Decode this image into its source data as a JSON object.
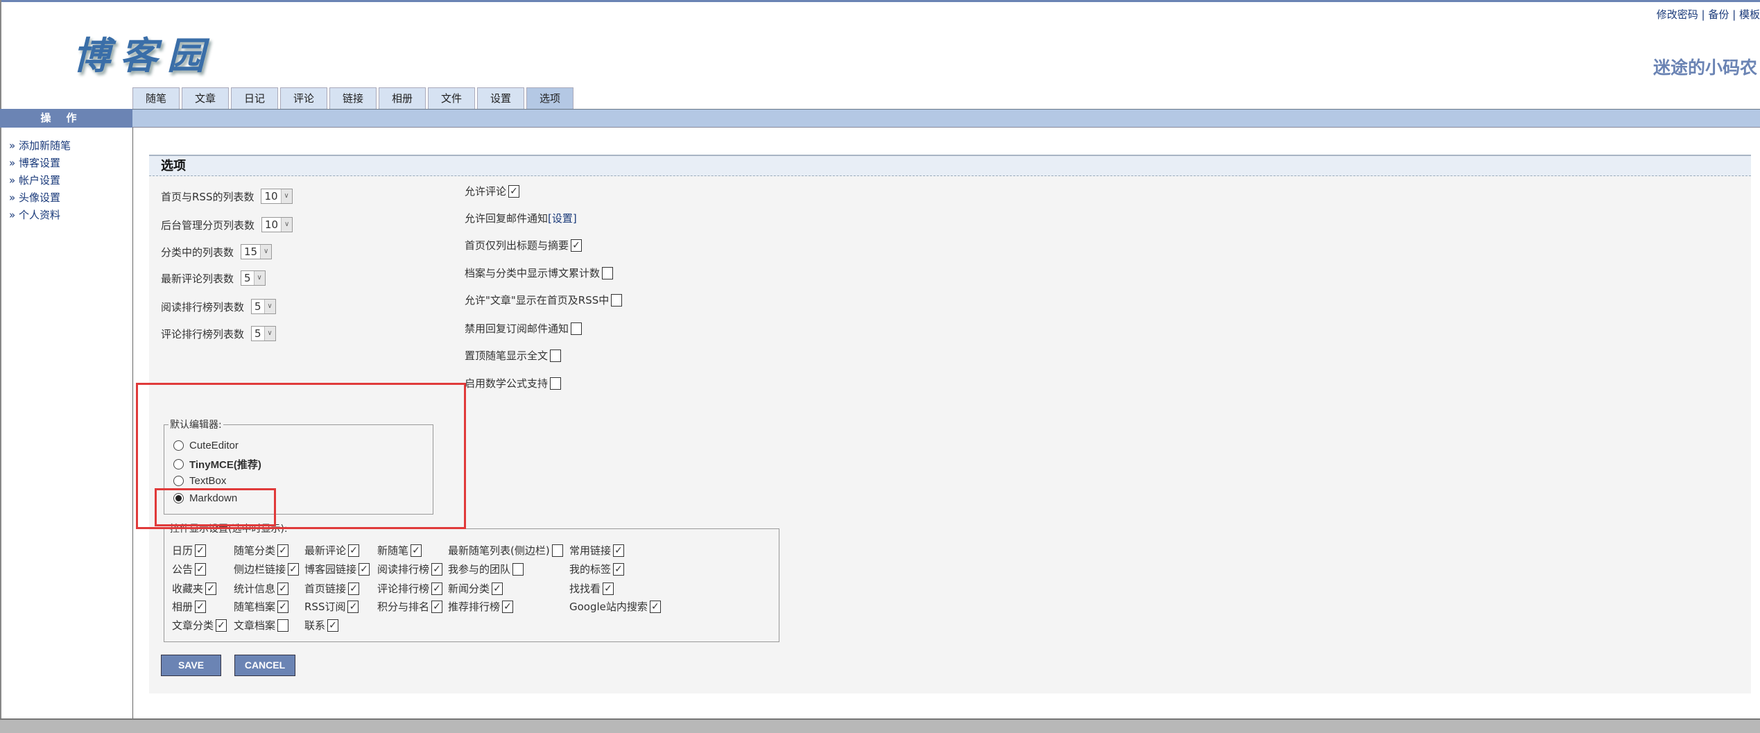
{
  "header": {
    "logo_text": "博客园",
    "links": [
      "修改密码",
      "备份",
      "模板"
    ],
    "blog_name": "迷途的小码农"
  },
  "tabs": [
    {
      "label": "随笔"
    },
    {
      "label": "文章"
    },
    {
      "label": "日记"
    },
    {
      "label": "评论"
    },
    {
      "label": "链接"
    },
    {
      "label": "相册"
    },
    {
      "label": "文件"
    },
    {
      "label": "设置"
    },
    {
      "label": "选项",
      "selected": true
    }
  ],
  "sidebar": {
    "title": "操作",
    "items": [
      "» 添加新随笔",
      "» 博客设置",
      "» 帐户设置",
      "» 头像设置",
      "» 个人资料"
    ]
  },
  "panel": {
    "title": "选项",
    "selects": [
      {
        "label": "首页与RSS的列表数",
        "value": "10"
      },
      {
        "label": "后台管理分页列表数",
        "value": "10"
      },
      {
        "label": "分类中的列表数",
        "value": "15"
      },
      {
        "label": "最新评论列表数",
        "value": "5"
      },
      {
        "label": "阅读排行榜列表数",
        "value": "5"
      },
      {
        "label": "评论排行榜列表数",
        "value": "5"
      }
    ],
    "options": [
      {
        "label": "允许评论",
        "checked": true
      },
      {
        "label": "允许回复邮件通知",
        "link": "[设置]"
      },
      {
        "label": "首页仅列出标题与摘要",
        "checked": true
      },
      {
        "label": "档案与分类中显示博文累计数",
        "checked": false
      },
      {
        "label": "允许\"文章\"显示在首页及RSS中",
        "checked": false
      },
      {
        "label": "禁用回复订阅邮件通知",
        "checked": false
      },
      {
        "label": "置顶随笔显示全文",
        "checked": false
      },
      {
        "label": "启用数学公式支持",
        "checked": false
      }
    ],
    "editor": {
      "legend": "默认编辑器:",
      "choices": [
        {
          "label": "CuteEditor",
          "selected": false
        },
        {
          "label": "TinyMCE(推荐)",
          "selected": false,
          "bold": true
        },
        {
          "label": "TextBox",
          "selected": false
        },
        {
          "label": "Markdown",
          "selected": true
        }
      ]
    },
    "controls": {
      "legend": "控件显示设置(选中时显示):",
      "rows": [
        [
          {
            "label": "日历",
            "checked": true
          },
          {
            "label": "随笔分类",
            "checked": true
          },
          {
            "label": "最新评论",
            "checked": true
          },
          {
            "label": "新随笔",
            "checked": true
          },
          {
            "label": "最新随笔列表(侧边栏)",
            "checked": false
          },
          {
            "label": "常用链接",
            "checked": true
          }
        ],
        [
          {
            "label": "公告",
            "checked": true
          },
          {
            "label": "侧边栏链接",
            "checked": true
          },
          {
            "label": "博客园链接",
            "checked": true
          },
          {
            "label": "阅读排行榜",
            "checked": true
          },
          {
            "label": "我参与的团队",
            "checked": false
          },
          {
            "label": "我的标签",
            "checked": true
          }
        ],
        [
          {
            "label": "收藏夹",
            "checked": true
          },
          {
            "label": "统计信息",
            "checked": true
          },
          {
            "label": "首页链接",
            "checked": true
          },
          {
            "label": "评论排行榜",
            "checked": true
          },
          {
            "label": "新闻分类",
            "checked": true
          },
          {
            "label": "找找看",
            "checked": true
          }
        ],
        [
          {
            "label": "相册",
            "checked": true
          },
          {
            "label": "随笔档案",
            "checked": true
          },
          {
            "label": "RSS订阅",
            "checked": true
          },
          {
            "label": "积分与排名",
            "checked": true
          },
          {
            "label": "推荐排行榜",
            "checked": true
          },
          {
            "label": "Google站内搜索",
            "checked": true
          }
        ],
        [
          {
            "label": "文章分类",
            "checked": true
          },
          {
            "label": "文章档案",
            "checked": false
          },
          {
            "label": "联系",
            "checked": true
          }
        ]
      ]
    },
    "save_label": "SAVE",
    "cancel_label": "CANCEL"
  },
  "colors": {
    "accent": "#6b84b4",
    "bar": "#b4c8e4",
    "highlight": "#e03a3a"
  }
}
